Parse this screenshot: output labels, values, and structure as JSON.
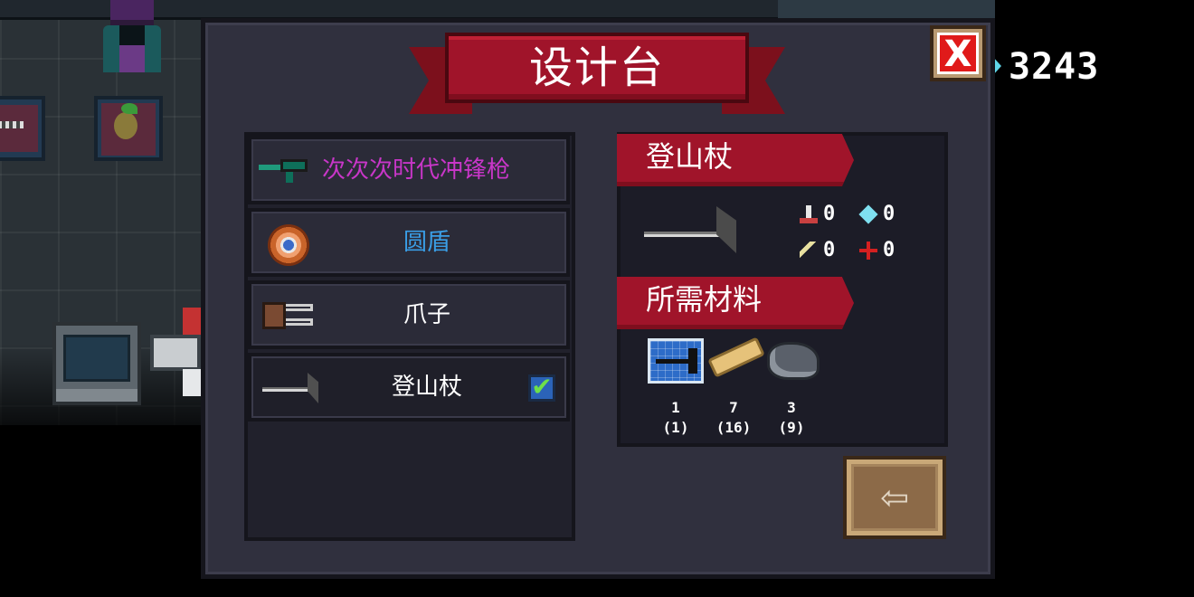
{
  "currency": {
    "gems": "3243"
  },
  "dialog": {
    "title": "设计台",
    "close_label": "X",
    "exit_glyph": "⇦"
  },
  "recipes": [
    {
      "label": "次次次时代冲锋枪",
      "color": "#c836c8",
      "icon": "smg-icon"
    },
    {
      "label": "圆盾",
      "color": "#3a9ee6",
      "icon": "round-shield-icon"
    },
    {
      "label": "爪子",
      "color": "#ffffff",
      "icon": "claw-icon"
    },
    {
      "label": "登山杖",
      "color": "#ffffff",
      "icon": "trekking-pole-icon",
      "selected": true,
      "checked": "✔"
    }
  ],
  "detail": {
    "name": "登山杖",
    "stats": {
      "damage": "0",
      "energy": "0",
      "crit": "0",
      "accuracy": "0"
    },
    "materials_title": "所需材料",
    "materials": [
      {
        "name": "blueprint-icon",
        "need": "1",
        "have": "(1)"
      },
      {
        "name": "wood-icon",
        "need": "7",
        "have": "(16)"
      },
      {
        "name": "ore-icon",
        "need": "3",
        "have": "(9)"
      }
    ]
  }
}
